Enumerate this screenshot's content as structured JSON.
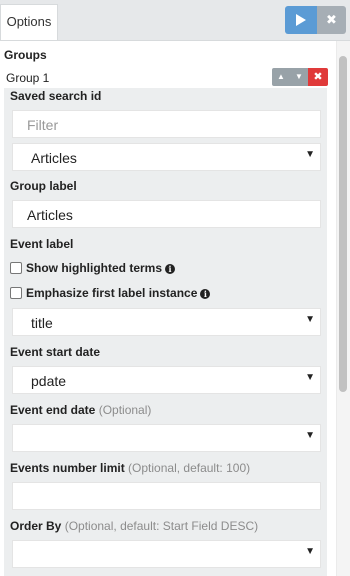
{
  "tabs": {
    "options": "Options"
  },
  "toolbar": {
    "run_icon": "play-icon",
    "discard_icon": "close-icon",
    "discard_glyph": "✖"
  },
  "groups": {
    "heading": "Groups",
    "group_name": "Group 1",
    "up_glyph": "▲",
    "down_glyph": "▼",
    "remove_glyph": "✖"
  },
  "form": {
    "saved_search": {
      "label": "Saved search id",
      "filter_placeholder": "Filter",
      "selected": "Articles"
    },
    "group_label": {
      "label": "Group label",
      "value": "Articles"
    },
    "event_label": {
      "label": "Event label",
      "show_highlighted": "Show highlighted terms",
      "emphasize_first": "Emphasize first label instance",
      "selected": "title"
    },
    "event_start": {
      "label": "Event start date",
      "selected": "pdate"
    },
    "event_end": {
      "label": "Event end date",
      "optional": "(Optional)",
      "selected": ""
    },
    "limit": {
      "label": "Events number limit",
      "optional": "(Optional, default: 100)",
      "value": ""
    },
    "order_by": {
      "label": "Order By",
      "optional": "(Optional, default: Start Field DESC)",
      "selected": ""
    },
    "caret": "▼",
    "info_glyph": "i"
  },
  "colors": {
    "run_button": "#5b9bd5",
    "discard_button": "#a6aeb5",
    "remove_button": "#e03a3a",
    "panel_bg": "#eceeef"
  }
}
